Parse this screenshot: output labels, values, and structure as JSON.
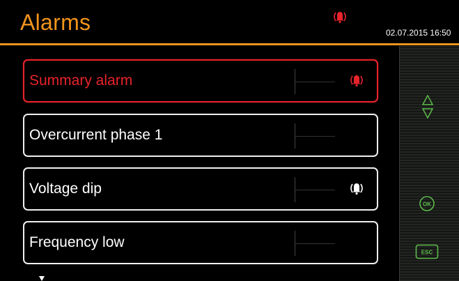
{
  "header": {
    "title": "Alarms",
    "datetime": "02.07.2015 16:50",
    "alarm_indicator_icon": "alarm-bell-icon"
  },
  "alarms": [
    {
      "label": "Summary alarm",
      "active": true,
      "icon": "alarm-bell-icon",
      "icon_color": "#e8232a"
    },
    {
      "label": "Overcurrent phase 1",
      "active": false,
      "icon": null
    },
    {
      "label": "Voltage dip",
      "active": false,
      "icon": "alarm-bell-icon",
      "icon_color": "#ffffff"
    },
    {
      "label": "Frequency low",
      "active": false,
      "icon": null
    }
  ],
  "controls": {
    "navigation_icon": "up-down-arrows-icon",
    "ok_label": "OK",
    "esc_label": "ESC"
  },
  "colors": {
    "accent": "#f2941e",
    "alarm_red": "#e8232a",
    "control_green": "#5dbb4a",
    "background": "#000000"
  }
}
